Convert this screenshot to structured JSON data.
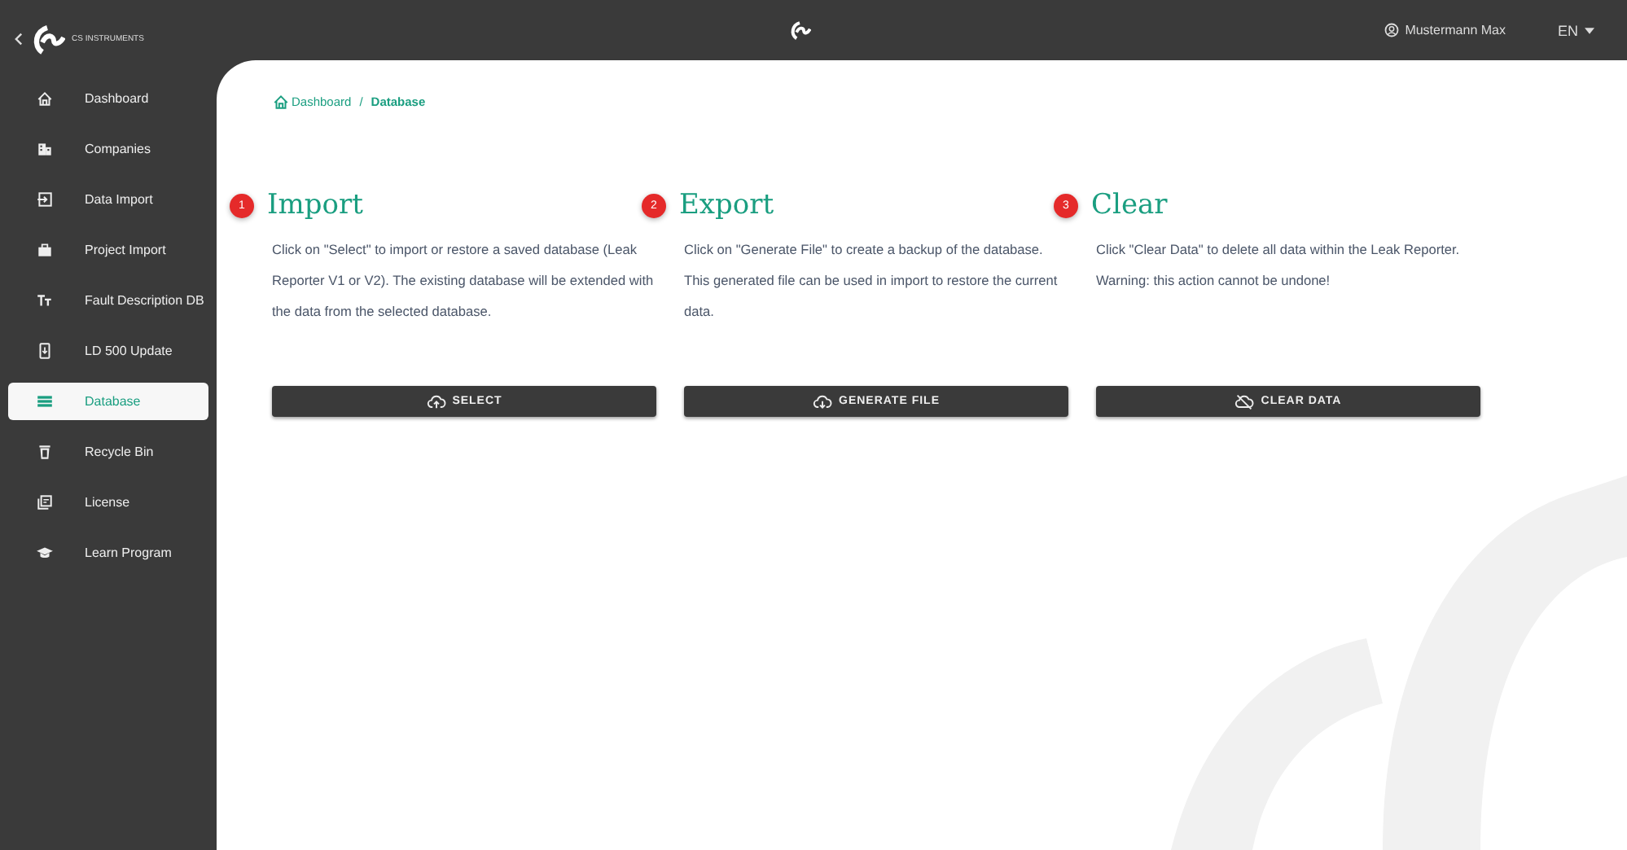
{
  "brand": {
    "name": "CS INSTRUMENTS"
  },
  "topbar": {
    "user": "Mustermann Max",
    "language": "EN"
  },
  "sidebar": {
    "items": [
      {
        "label": "Dashboard",
        "selected": false
      },
      {
        "label": "Companies",
        "selected": false
      },
      {
        "label": "Data Import",
        "selected": false
      },
      {
        "label": "Project Import",
        "selected": false
      },
      {
        "label": "Fault Description DB",
        "selected": false
      },
      {
        "label": "LD 500 Update",
        "selected": false
      },
      {
        "label": "Database",
        "selected": true
      },
      {
        "label": "Recycle Bin",
        "selected": false
      },
      {
        "label": "License",
        "selected": false
      },
      {
        "label": "Learn Program",
        "selected": false
      }
    ]
  },
  "breadcrumb": {
    "separator": "/",
    "items": [
      {
        "label": "Dashboard"
      },
      {
        "label": "Database"
      }
    ]
  },
  "sections": [
    {
      "number": "1",
      "title": "Import",
      "text": "Click on \"Select\" to import or restore a saved database (Leak Reporter V1 or V2). The existing database will be extended with the data from the selected database.",
      "button": "SELECT"
    },
    {
      "number": "2",
      "title": "Export",
      "text": "Click on \"Generate File\" to create a backup of the database. This generated file can be used in import to restore the current data.",
      "button": "GENERATE FILE"
    },
    {
      "number": "3",
      "title": "Clear",
      "text": "Click \"Clear Data\" to delete all data within the Leak Reporter. Warning: this action cannot be undone!",
      "button": "CLEAR DATA"
    }
  ]
}
